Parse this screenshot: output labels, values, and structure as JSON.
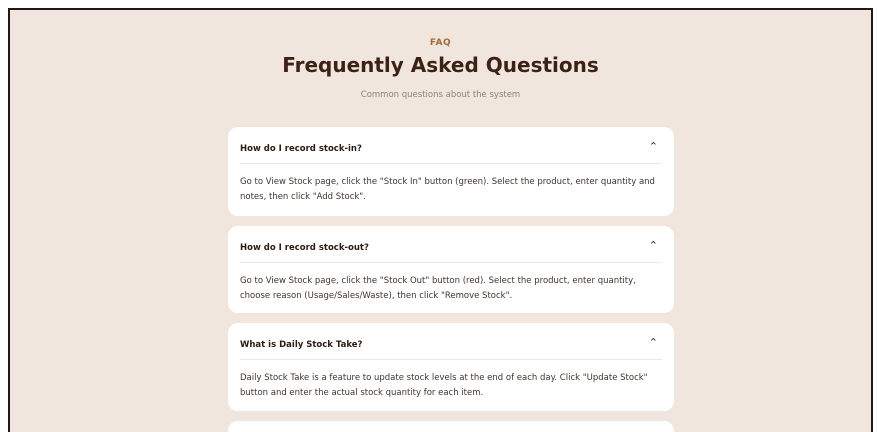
{
  "header": {
    "eyebrow": "FAQ",
    "title": "Frequently Asked Questions",
    "subtitle": "Common questions about the system"
  },
  "faqs": [
    {
      "question": "How do I record stock-in?",
      "answer": "Go to View Stock page, click the \"Stock In\" button (green). Select the product, enter quantity and notes, then click \"Add Stock\".",
      "expanded": true
    },
    {
      "question": "How do I record stock-out?",
      "answer": "Go to View Stock page, click the \"Stock Out\" button (red). Select the product, enter quantity, choose reason (Usage/Sales/Waste), then click \"Remove Stock\".",
      "expanded": true
    },
    {
      "question": "What is Daily Stock Take?",
      "answer": "Daily Stock Take is a feature to update stock levels at the end of each day. Click \"Update Stock\" button and enter the actual stock quantity for each item.",
      "expanded": true
    }
  ],
  "icons": {
    "chevron": "chevron-up-icon"
  },
  "colors": {
    "background": "#f1e6dd",
    "accent": "#a06a37",
    "title": "#3c2216",
    "card": "#ffffff"
  }
}
